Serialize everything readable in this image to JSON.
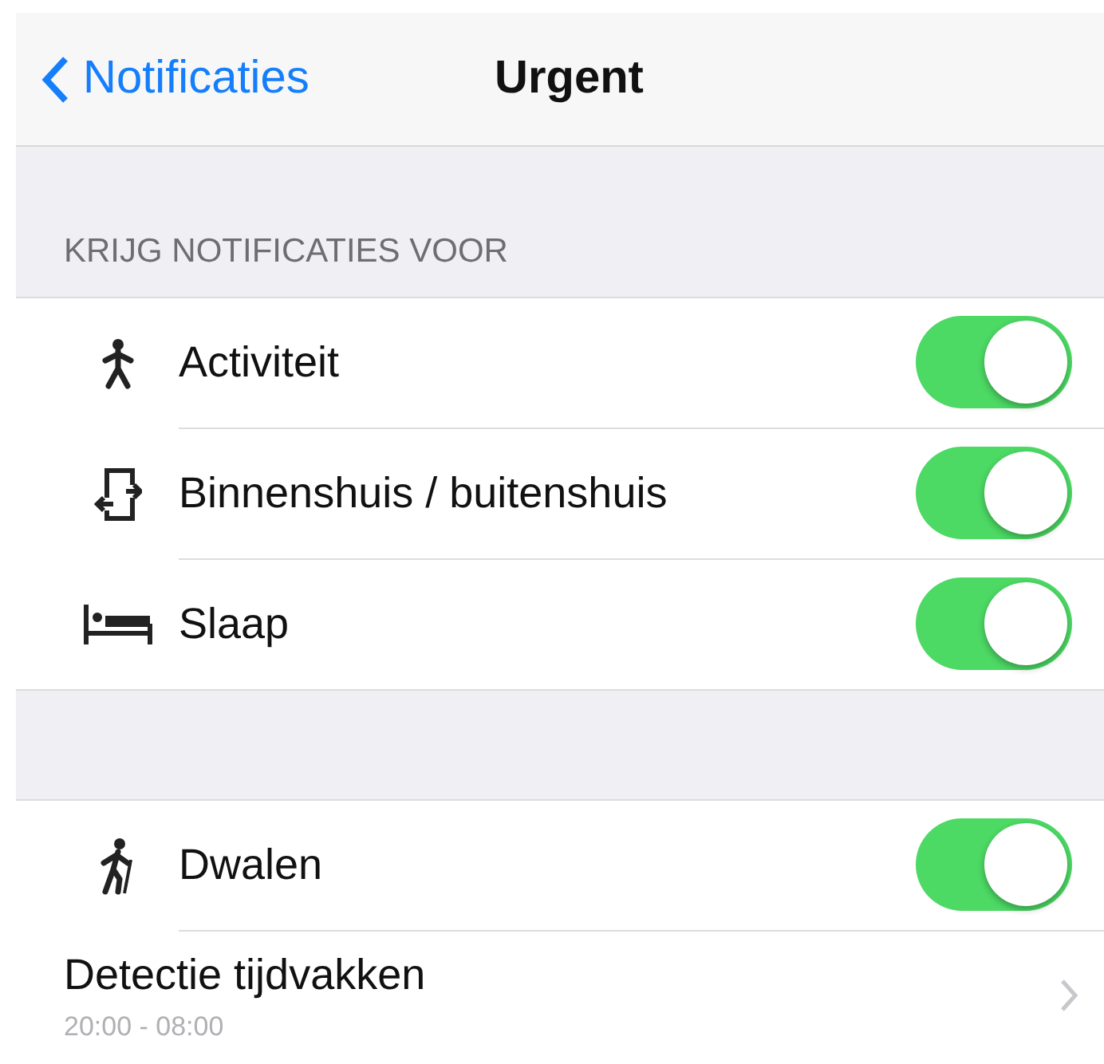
{
  "nav": {
    "back": "Notificaties",
    "title": "Urgent"
  },
  "sections": [
    {
      "header": "KRIJG NOTIFICATIES VOOR",
      "rows": [
        {
          "kind": "toggle",
          "label": "Activiteit",
          "on": true
        },
        {
          "kind": "toggle",
          "label": "Binnenshuis / buitenshuis",
          "on": true
        },
        {
          "kind": "toggle",
          "label": "Slaap",
          "on": true
        }
      ]
    },
    {
      "rows": [
        {
          "kind": "toggle",
          "label": "Dwalen",
          "on": true
        },
        {
          "kind": "link",
          "label": "Detectie tijdvakken",
          "detail": "20:00 - 08:00"
        }
      ]
    }
  ]
}
